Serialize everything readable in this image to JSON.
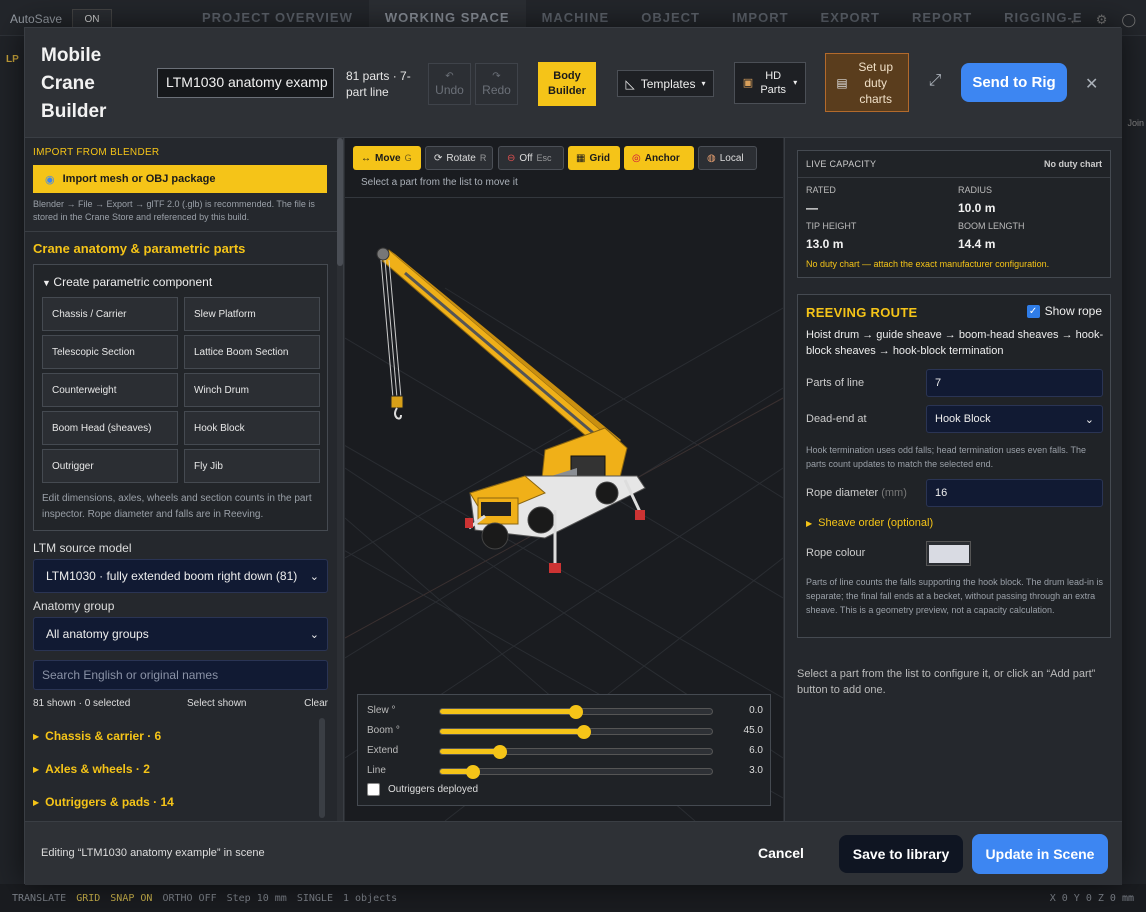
{
  "bg": {
    "autosave": "AutoSave",
    "autosave_state": "ON",
    "tabs": [
      "PROJECT OVERVIEW",
      "WORKING SPACE",
      "MACHINE",
      "OBJECT",
      "IMPORT",
      "EXPORT",
      "REPORT",
      "RIGGING-E"
    ],
    "lp_label": "LP",
    "join_label": "Join",
    "status": {
      "translate": "TRANSLATE",
      "grid": "GRID",
      "snap": "SNAP ON",
      "ortho": "ORTHO OFF",
      "step": "Step 10 mm",
      "single": "SINGLE",
      "objects": "1 objects",
      "coords": "X 0  Y 0  Z 0  mm"
    }
  },
  "header": {
    "title": "Mobile Crane Builder",
    "name_value": "LTM1030 anatomy examp",
    "parts_info": "81 parts · 7-part line",
    "undo": "Undo",
    "redo": "Redo",
    "body_builder": "Body Builder",
    "templates": "Templates",
    "hd_parts": "HD Parts",
    "duty_charts": "Set up duty charts",
    "send_to_rig": "Send to Rig"
  },
  "left": {
    "import_heading": "IMPORT FROM BLENDER",
    "import_button": "Import mesh or OBJ package",
    "import_note": "Blender → File → Export → glTF 2.0 (.glb) is recommended. The file is stored in the Crane Store and referenced by this build.",
    "anatomy_heading": "Crane anatomy & parametric parts",
    "param_title": "Create parametric component",
    "components": [
      "Chassis / Carrier",
      "Slew Platform",
      "Telescopic Section",
      "Lattice Boom Section",
      "Counterweight",
      "Winch Drum",
      "Boom Head (sheaves)",
      "Hook Block",
      "Outrigger",
      "Fly Jib"
    ],
    "param_note": "Edit dimensions, axles, wheels and section counts in the part inspector. Rope diameter and falls are in Reeving.",
    "source_label": "LTM source model",
    "source_value": "LTM1030 · fully extended boom right down (81)",
    "group_label": "Anatomy group",
    "group_value": "All anatomy groups",
    "search_placeholder": "Search English or original names",
    "shown": "81 shown · 0 selected",
    "select_shown": "Select shown",
    "clear": "Clear",
    "groups": [
      "Chassis & carrier · 6",
      "Axles & wheels · 2",
      "Outriggers & pads · 14"
    ]
  },
  "viewport": {
    "tools": [
      {
        "label": "Move",
        "key": "G",
        "icon": "↔"
      },
      {
        "label": "Rotate",
        "key": "R",
        "icon": "⟳"
      },
      {
        "label": "Off",
        "key": "Esc",
        "icon": "⊖"
      },
      {
        "label": "Grid",
        "key": "",
        "icon": "▦"
      },
      {
        "label": "Anchor",
        "key": "",
        "icon": "◎"
      },
      {
        "label": "Local",
        "key": "",
        "icon": "◍"
      }
    ],
    "hint": "Select a part from the list to move it",
    "sliders": [
      {
        "label": "Slew °",
        "value": "0.0",
        "fraction": 0.5
      },
      {
        "label": "Boom °",
        "value": "45.0",
        "fraction": 0.53
      },
      {
        "label": "Extend",
        "value": "6.0",
        "fraction": 0.22
      },
      {
        "label": "Line",
        "value": "3.0",
        "fraction": 0.12
      }
    ],
    "outriggers": "Outriggers deployed"
  },
  "right": {
    "cap_heading": "LIVE CAPACITY",
    "cap_status": "No duty chart",
    "rated_label": "RATED",
    "rated_value": "—",
    "radius_label": "RADIUS",
    "radius_value": "10.0 m",
    "tip_label": "TIP HEIGHT",
    "tip_value": "13.0 m",
    "boom_label": "BOOM LENGTH",
    "boom_value": "14.4 m",
    "cap_warning": "No duty chart — attach the exact manufacturer configuration.",
    "reev_heading": "REEVING ROUTE",
    "show_rope": "Show rope",
    "reev_path": "Hoist drum → guide sheave → boom-head sheaves → hook-block sheaves → hook-block termination",
    "parts_label": "Parts of line",
    "parts_value": "7",
    "dead_label": "Dead-end at",
    "dead_value": "Hook Block",
    "dead_note": "Hook termination uses odd falls; head termination uses even falls. The parts count updates to match the selected end.",
    "rope_label": "Rope diameter",
    "rope_unit": "(mm)",
    "rope_value": "16",
    "sheave_order": "Sheave order (optional)",
    "colour_label": "Rope colour",
    "colour_value": "#d9dbe3",
    "reev_note": "Parts of line counts the falls supporting the hook block. The drum lead-in is separate; the final fall ends at a becket, without passing through an extra sheave. This is a geometry preview, not a capacity calculation.",
    "select_msg": "Select a part from the list to configure it, or click an “Add part” button to add one."
  },
  "footer": {
    "edit_msg": "Editing “LTM1030 anatomy example” in scene",
    "cancel": "Cancel",
    "save_library": "Save to library",
    "update_scene": "Update in Scene"
  },
  "colors": {
    "accent": "#f5c418",
    "primary": "#3d86f2",
    "duty": "#5a3d1d"
  }
}
